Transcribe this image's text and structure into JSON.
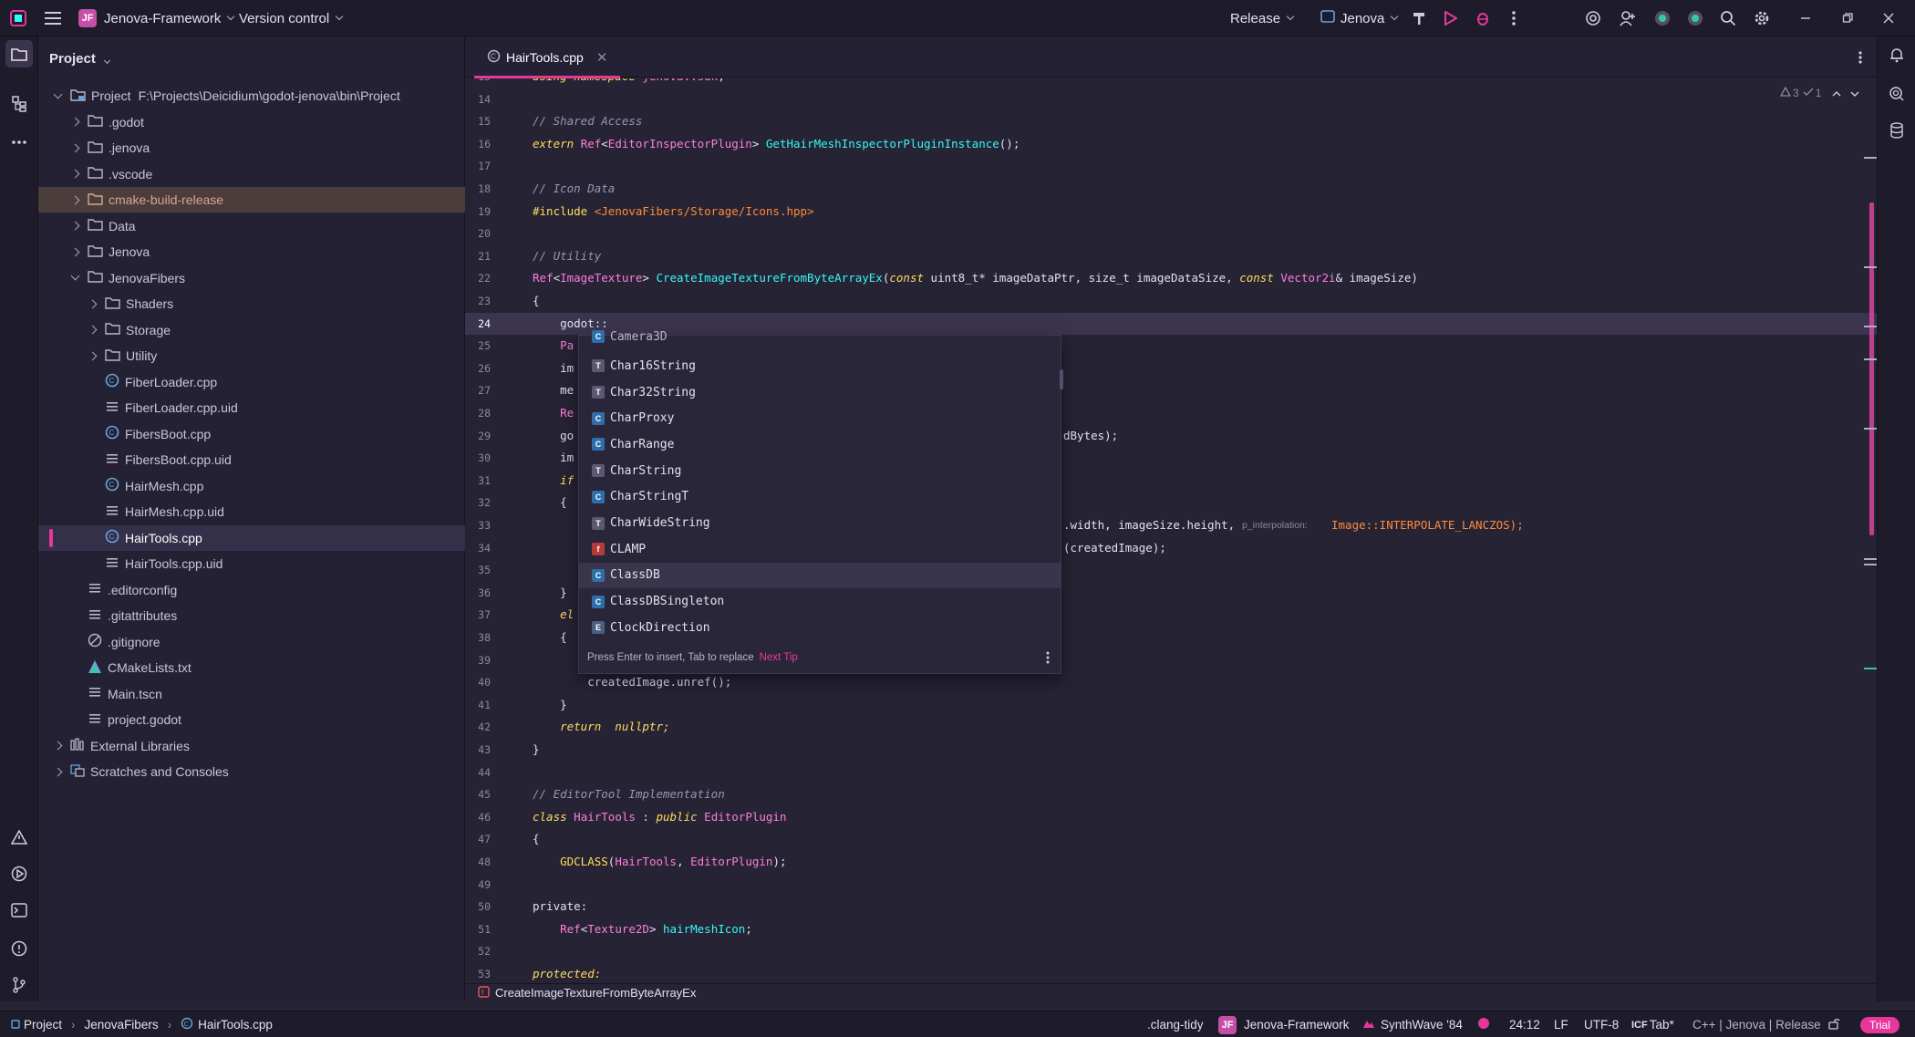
{
  "topbar": {
    "project_badge": "JF",
    "project_name": "Jenova-Framework",
    "vcs": "Version control",
    "config": "Release",
    "run_target": "Jenova"
  },
  "project_panel": {
    "title": "Project",
    "root_label": "Project",
    "root_path": "F:\\Projects\\Deicidium\\godot-jenova\\bin\\Project",
    "items": [
      {
        "label": ".godot"
      },
      {
        "label": ".jenova"
      },
      {
        "label": ".vscode"
      },
      {
        "label": "cmake-build-release"
      },
      {
        "label": "Data"
      },
      {
        "label": "Jenova"
      },
      {
        "label": "JenovaFibers"
      },
      {
        "label": "Shaders"
      },
      {
        "label": "Storage"
      },
      {
        "label": "Utility"
      },
      {
        "label": "FiberLoader.cpp"
      },
      {
        "label": "FiberLoader.cpp.uid"
      },
      {
        "label": "FibersBoot.cpp"
      },
      {
        "label": "FibersBoot.cpp.uid"
      },
      {
        "label": "HairMesh.cpp"
      },
      {
        "label": "HairMesh.cpp.uid"
      },
      {
        "label": "HairTools.cpp"
      },
      {
        "label": "HairTools.cpp.uid"
      },
      {
        "label": ".editorconfig"
      },
      {
        "label": ".gitattributes"
      },
      {
        "label": ".gitignore"
      },
      {
        "label": "CMakeLists.txt"
      },
      {
        "label": "Main.tscn"
      },
      {
        "label": "project.godot"
      },
      {
        "label": "External Libraries"
      },
      {
        "label": "Scratches and Consoles"
      }
    ]
  },
  "editor": {
    "tab_label": "HairTools.cpp",
    "inspection_warnings": "3",
    "inspection_ok": "1",
    "lines": [
      {
        "n": "14",
        "t": ""
      },
      {
        "n": "15",
        "t": "// Shared Access"
      },
      {
        "n": "16",
        "t": "extern Ref<EditorInspectorPlugin> GetHairMeshInspectorPluginInstance();"
      },
      {
        "n": "17",
        "t": ""
      },
      {
        "n": "18",
        "t": "// Icon Data"
      },
      {
        "n": "19",
        "t": "#include <JenovaFibers/Storage/Icons.hpp>"
      },
      {
        "n": "20",
        "t": ""
      },
      {
        "n": "21",
        "t": "// Utility"
      },
      {
        "n": "22",
        "t": "Ref<ImageTexture> CreateImageTextureFromByteArrayEx(const uint8_t* imageDataPtr, size_t imageDataSize, const Vector2i& imageSize)"
      },
      {
        "n": "23",
        "t": "{"
      },
      {
        "n": "24",
        "t": "    godot::"
      },
      {
        "n": "25",
        "t": "    Pa"
      },
      {
        "n": "26",
        "t": "    im"
      },
      {
        "n": "27",
        "t": "    me"
      },
      {
        "n": "28",
        "t": "    Re"
      },
      {
        "n": "29",
        "t": "    go"
      },
      {
        "n": "30",
        "t": "    im"
      },
      {
        "n": "31",
        "t": "    if"
      },
      {
        "n": "32",
        "t": "    {"
      },
      {
        "n": "33",
        "t": ""
      },
      {
        "n": "34",
        "t": ""
      },
      {
        "n": "35",
        "t": ""
      },
      {
        "n": "36",
        "t": "    }"
      },
      {
        "n": "37",
        "t": "    el"
      },
      {
        "n": "38",
        "t": "    {"
      },
      {
        "n": "39",
        "t": ""
      },
      {
        "n": "40",
        "t": "        createdImage.unref();"
      },
      {
        "n": "41",
        "t": "    }"
      },
      {
        "n": "42",
        "t": "    return  nullptr;"
      },
      {
        "n": "43",
        "t": "}"
      },
      {
        "n": "44",
        "t": ""
      },
      {
        "n": "45",
        "t": "// EditorTool Implementation"
      },
      {
        "n": "46",
        "t": "class HairTools : public EditorPlugin"
      },
      {
        "n": "47",
        "t": "{"
      },
      {
        "n": "48",
        "t": "    GDCLASS(HairTools, EditorPlugin);"
      },
      {
        "n": "49",
        "t": ""
      },
      {
        "n": "50",
        "t": "private:"
      },
      {
        "n": "51",
        "t": "    Ref<Texture2D> hairMeshIcon;"
      },
      {
        "n": "52",
        "t": ""
      },
      {
        "n": "53",
        "t": "protected:"
      }
    ],
    "line29_tail": "dBytes);",
    "line33_tail": ".width, imageSize.height,",
    "line33_hint": "p_interpolation:",
    "line33_rest": "Image::INTERPOLATE_LANCZOS);",
    "line34_tail": "(createdImage);",
    "truncated_top": "using namespace jenova::sdk;"
  },
  "completion": {
    "partial": "Camera3D",
    "items": [
      {
        "kind": "T",
        "label": "Char16String"
      },
      {
        "kind": "T",
        "label": "Char32String"
      },
      {
        "kind": "C",
        "label": "CharProxy"
      },
      {
        "kind": "C",
        "label": "CharRange"
      },
      {
        "kind": "T",
        "label": "CharString"
      },
      {
        "kind": "C",
        "label": "CharStringT"
      },
      {
        "kind": "T",
        "label": "CharWideString"
      },
      {
        "kind": "F",
        "label": "CLAMP"
      },
      {
        "kind": "C",
        "label": "ClassDB"
      },
      {
        "kind": "C",
        "label": "ClassDBSingleton"
      },
      {
        "kind": "E",
        "label": "ClockDirection"
      }
    ],
    "footer": "Press Enter to insert, Tab to replace",
    "next_tip": "Next Tip"
  },
  "bottom_breadcrumb": "CreateImageTextureFromByteArrayEx",
  "statusbar": {
    "crumbs": [
      "Project",
      "JenovaFibers",
      "HairTools.cpp"
    ],
    "clang_tidy": ".clang-tidy",
    "project_badge": "JF",
    "project": "Jenova-Framework",
    "theme": "SynthWave '84",
    "position": "24:12",
    "line_ending": "LF",
    "encoding": "UTF-8",
    "indent": "Tab*",
    "context": "C++ | Jenova | Release",
    "trial": "Trial"
  }
}
